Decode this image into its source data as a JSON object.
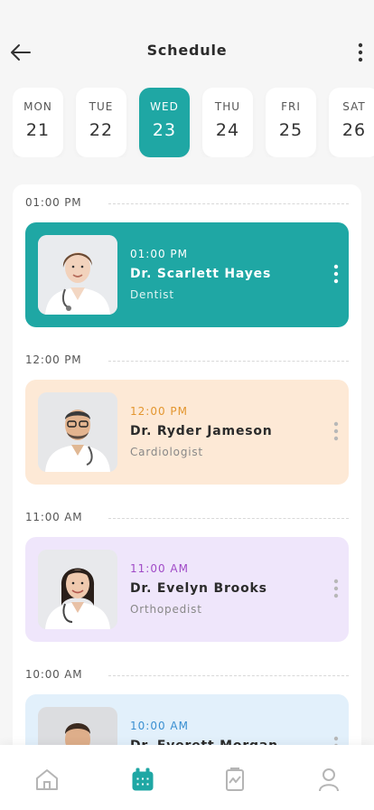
{
  "header": {
    "title": "Schedule"
  },
  "days": [
    {
      "name": "MON",
      "num": "21",
      "active": false
    },
    {
      "name": "TUE",
      "num": "22",
      "active": false
    },
    {
      "name": "WED",
      "num": "23",
      "active": true
    },
    {
      "name": "THU",
      "num": "24",
      "active": false
    },
    {
      "name": "FRI",
      "num": "25",
      "active": false
    },
    {
      "name": "SAT",
      "num": "26",
      "active": false
    }
  ],
  "slots": [
    {
      "label": "01:00 PM",
      "time": "01:00 PM",
      "name": "Dr. Scarlett Hayes",
      "specialty": "Dentist",
      "bg": "#1fa7a4",
      "time_color": "#ffffff",
      "name_color": "#ffffff",
      "spec_color": "#dff4f3",
      "dots_color": "#ffffff",
      "photo": "female-doctor"
    },
    {
      "label": "12:00 PM",
      "time": "12:00 PM",
      "name": "Dr. Ryder Jameson",
      "specialty": "Cardiologist",
      "bg": "#fde9d6",
      "time_color": "#e3962f",
      "name_color": "#2b2b2b",
      "spec_color": "#888888",
      "dots_color": "#b8b8b8",
      "photo": "male-doctor"
    },
    {
      "label": "11:00 AM",
      "time": "11:00 AM",
      "name": "Dr. Evelyn Brooks",
      "specialty": "Orthopedist",
      "bg": "#efe6fb",
      "time_color": "#a04ac7",
      "name_color": "#2b2b2b",
      "spec_color": "#888888",
      "dots_color": "#b8b8b8",
      "photo": "female-doctor-dark"
    },
    {
      "label": "10:00 AM",
      "time": "10:00 AM",
      "name": "Dr. Everett Morgan",
      "specialty": "",
      "bg": "#e2f0fb",
      "time_color": "#3a8fd1",
      "name_color": "#2b2b2b",
      "spec_color": "#888888",
      "dots_color": "#b8b8b8",
      "photo": "male-doctor-beard"
    }
  ],
  "tabs": [
    {
      "icon": "home-icon",
      "active": false
    },
    {
      "icon": "calendar-icon",
      "active": true
    },
    {
      "icon": "report-icon",
      "active": false
    },
    {
      "icon": "user-icon",
      "active": false
    }
  ],
  "colors": {
    "accent": "#1fa7a4",
    "inactive_icon": "#b5b5b5"
  }
}
